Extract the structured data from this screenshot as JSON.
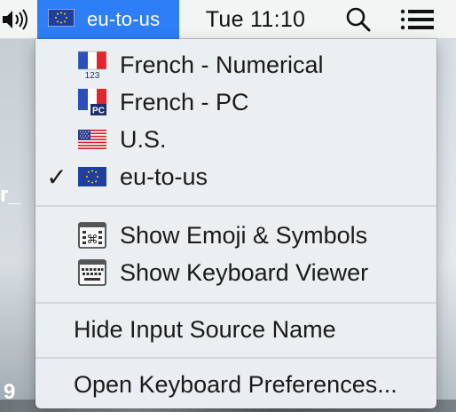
{
  "menubar": {
    "volume_icon": "speaker-volume-icon",
    "input_source": {
      "flag_icon": "eu-flag-icon",
      "label": "eu-to-us"
    },
    "clock": "Tue 11:10",
    "search_icon": "spotlight-search-icon",
    "list_icon": "notification-center-icon",
    "highlight_color": "#2d7ef7"
  },
  "background": {
    "left_text_1": "r_",
    "left_text_2": "9"
  },
  "menu": {
    "input_sources": [
      {
        "label": "French - Numerical",
        "icon": "french-numerical-flag-icon",
        "checked": false
      },
      {
        "label": "French - PC",
        "icon": "french-pc-flag-icon",
        "checked": false
      },
      {
        "label": "U.S.",
        "icon": "us-flag-icon",
        "checked": false
      },
      {
        "label": "eu-to-us",
        "icon": "eu-flag-icon",
        "checked": true,
        "check_mark": "✓"
      }
    ],
    "viewers": [
      {
        "label": "Show Emoji & Symbols",
        "icon": "emoji-symbols-icon"
      },
      {
        "label": "Show Keyboard Viewer",
        "icon": "keyboard-viewer-icon"
      }
    ],
    "hide_name": {
      "label": "Hide Input Source Name"
    },
    "preferences": {
      "label": "Open Keyboard Preferences..."
    }
  }
}
